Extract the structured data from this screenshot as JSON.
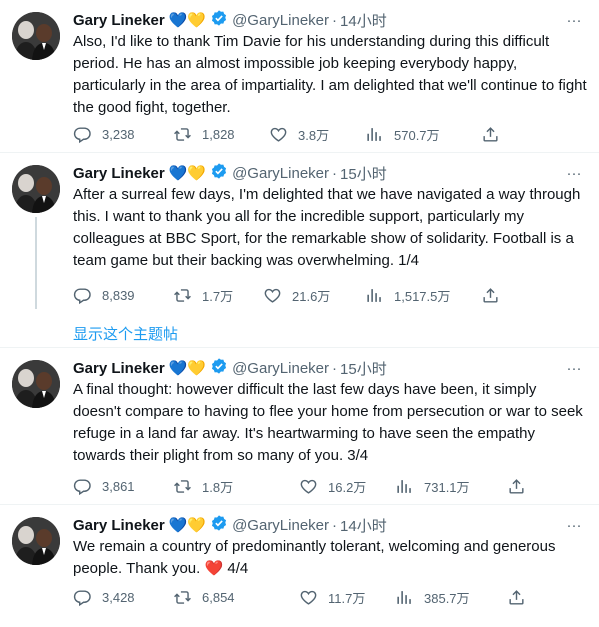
{
  "tweets": [
    {
      "name": "Gary Lineker",
      "emoji": "💙💛",
      "handle": "@GaryLineker",
      "dot": "·",
      "time": "14小时",
      "text": "Also, I'd like to thank Tim Davie for his understanding during this difficult period. He has an almost impossible job keeping everybody happy, particularly in the area of impartiality. I am delighted that we'll continue to fight the good fight, together.",
      "replies": "3,238",
      "retweets": "1,828",
      "likes": "3.8万",
      "views": "570.7万"
    },
    {
      "name": "Gary Lineker",
      "emoji": "💙💛",
      "handle": "@GaryLineker",
      "dot": "·",
      "time": "15小时",
      "text": "After a surreal few days, I'm delighted that we have navigated a way through this. I want to thank you all for the incredible support, particularly my colleagues at BBC Sport, for the remarkable show of solidarity. Football is a team game but their backing was overwhelming. 1/4",
      "replies": "8,839",
      "retweets": "1.7万",
      "likes": "21.6万",
      "views": "1,517.5万"
    },
    {
      "name": "Gary Lineker",
      "emoji": "💙💛",
      "handle": "@GaryLineker",
      "dot": "·",
      "time": "15小时",
      "text": "A final thought: however difficult the last few days have been, it simply doesn't compare to having to flee your home from persecution or war to seek refuge in a land far away. It's heartwarming to have seen the empathy towards their plight from so many of you. 3/4",
      "replies": "3,861",
      "retweets": "1.8万",
      "likes": "16.2万",
      "views": "731.1万"
    },
    {
      "name": "Gary Lineker",
      "emoji": "💙💛",
      "handle": "@GaryLineker",
      "dot": "·",
      "time": "14小时",
      "text_main": "We remain a country of predominantly tolerant, welcoming and generous people. Thank you.",
      "text_heart": "❤️",
      "text_tail": "4/4",
      "replies": "3,428",
      "retweets": "6,854",
      "likes": "11.7万",
      "views": "385.7万"
    }
  ],
  "show_thread": "显示这个主题帖",
  "more_glyph": "···",
  "icons": [
    "reply-icon",
    "retweet-icon",
    "like-icon",
    "views-icon",
    "share-icon",
    "verified-badge-icon",
    "more-icon"
  ],
  "colors": {
    "accent": "#1d9bf0",
    "muted": "#536471",
    "text": "#0f1419",
    "divider": "#eff3f4",
    "thread_line": "#cfd9de"
  }
}
